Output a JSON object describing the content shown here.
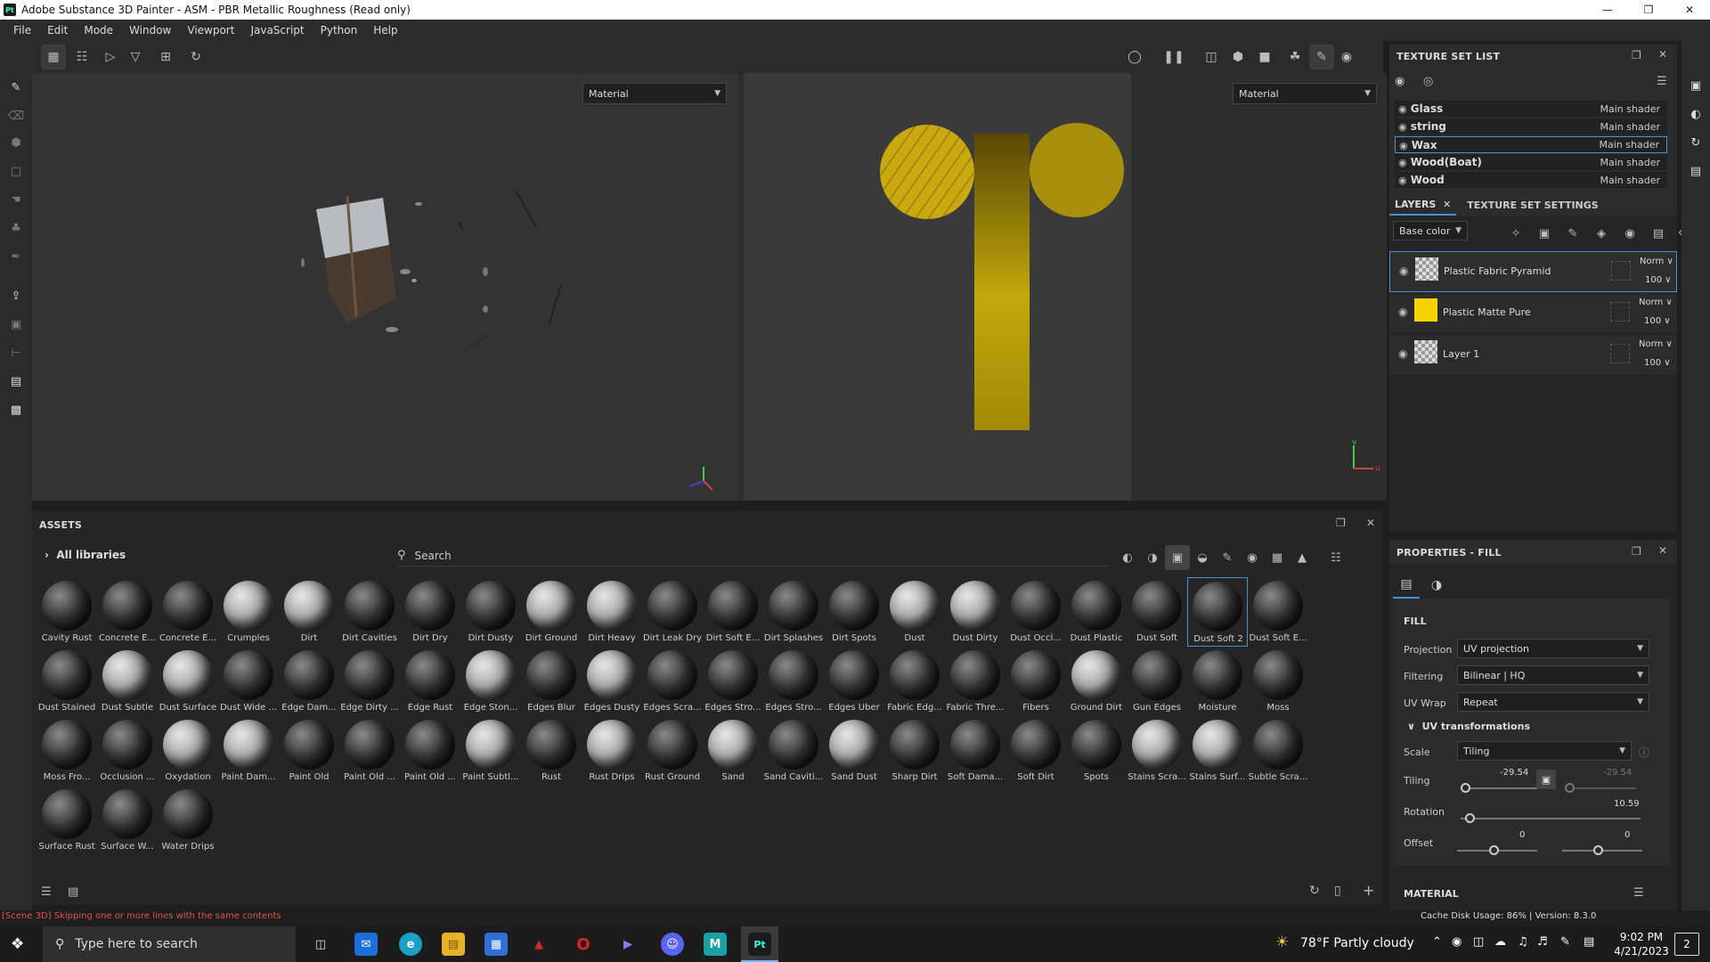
{
  "window": {
    "title": "Adobe Substance 3D Painter - ASM - PBR Metallic Roughness (Read only)",
    "app_badge": "Pt"
  },
  "menu": [
    "File",
    "Edit",
    "Mode",
    "Window",
    "Viewport",
    "JavaScript",
    "Python",
    "Help"
  ],
  "viewport": {
    "left_mode": "Material",
    "right_mode": "Material",
    "uv_v": "v",
    "uv_u": "u"
  },
  "texture_sets": {
    "title": "TEXTURE SET LIST",
    "items": [
      {
        "name": "Glass",
        "shader": "Main shader",
        "selected": false
      },
      {
        "name": "string",
        "shader": "Main shader",
        "selected": false
      },
      {
        "name": "Wax",
        "shader": "Main shader",
        "selected": true
      },
      {
        "name": "Wood(Boat)",
        "shader": "Main shader",
        "selected": false
      },
      {
        "name": "Wood",
        "shader": "Main shader",
        "selected": false
      }
    ]
  },
  "layers": {
    "tab_layers": "LAYERS",
    "tab_settings": "TEXTURE SET SETTINGS",
    "channel": "Base color",
    "items": [
      {
        "name": "Plastic Fabric Pyramid",
        "blend": "Norm",
        "opacity": "100",
        "thumb": "checker",
        "selected": true
      },
      {
        "name": "Plastic Matte Pure",
        "blend": "Norm",
        "opacity": "100",
        "thumb": "#f2d200",
        "selected": false
      },
      {
        "name": "Layer 1",
        "blend": "Norm",
        "opacity": "100",
        "thumb": "checker",
        "selected": false
      }
    ]
  },
  "assets": {
    "title": "ASSETS",
    "library": "All libraries",
    "search_placeholder": "Search",
    "items": [
      "Cavity Rust",
      "Concrete E...",
      "Concrete E...",
      "Crumples",
      "Dirt",
      "Dirt Cavities",
      "Dirt Dry",
      "Dirt Dusty",
      "Dirt Ground",
      "Dirt Heavy",
      "Dirt Leak Dry",
      "Dirt Soft E...",
      "Dirt Splashes",
      "Dirt Spots",
      "Dust",
      "Dust Dirty",
      "Dust Occl...",
      "Dust Plastic",
      "Dust Soft",
      "Dust Soft 2",
      "Dust Soft E...",
      "Dust Stained",
      "Dust Subtle",
      "Dust Surface",
      "Dust Wide ...",
      "Edge Dam...",
      "Edge Dirty ...",
      "Edge Rust",
      "Edge Ston...",
      "Edges Blur",
      "Edges Dusty",
      "Edges Scra...",
      "Edges Stro...",
      "Edges Stro...",
      "Edges Uber",
      "Fabric Edg...",
      "Fabric Thre...",
      "Fibers",
      "Ground Dirt",
      "Gun Edges",
      "Moisture",
      "Moss",
      "Moss Fro...",
      "Occlusion ...",
      "Oxydation",
      "Paint Dam...",
      "Paint Old",
      "Paint Old ...",
      "Paint Old ...",
      "Paint Subtl...",
      "Rust",
      "Rust Drips",
      "Rust Ground",
      "Sand",
      "Sand Caviti...",
      "Sand Dust",
      "Sharp Dirt",
      "Soft Dama...",
      "Soft Dirt",
      "Spots",
      "Stains Scra...",
      "Stains Surf...",
      "Subtle Scra...",
      "Surface Rust",
      "Surface W...",
      "Water Drips"
    ],
    "selected_index": 19
  },
  "properties": {
    "title": "PROPERTIES - FILL",
    "section_fill": "FILL",
    "projection_label": "Projection",
    "projection": "UV projection",
    "filtering_label": "Filtering",
    "filtering": "Bilinear | HQ",
    "uvwrap_label": "UV Wrap",
    "uvwrap": "Repeat",
    "uv_transform": "UV transformations",
    "scale_label": "Scale",
    "scale": "Tiling",
    "tiling_label": "Tiling",
    "tiling_u": "-29.54",
    "tiling_v": "-29.54",
    "rotation_label": "Rotation",
    "rotation": "10.59",
    "offset_label": "Offset",
    "offset_u": "0",
    "offset_v": "0",
    "section_material": "MATERIAL"
  },
  "status": {
    "log": "[Scene 3D] Skipping one or more lines with the same contents",
    "cache": "Cache Disk Usage:  86% | Version: 8.3.0"
  },
  "taskbar": {
    "search_placeholder": "Type here to search",
    "weather": "78°F  Partly cloudy",
    "time": "9:02 PM",
    "date": "4/21/2023",
    "notifications": "2"
  }
}
